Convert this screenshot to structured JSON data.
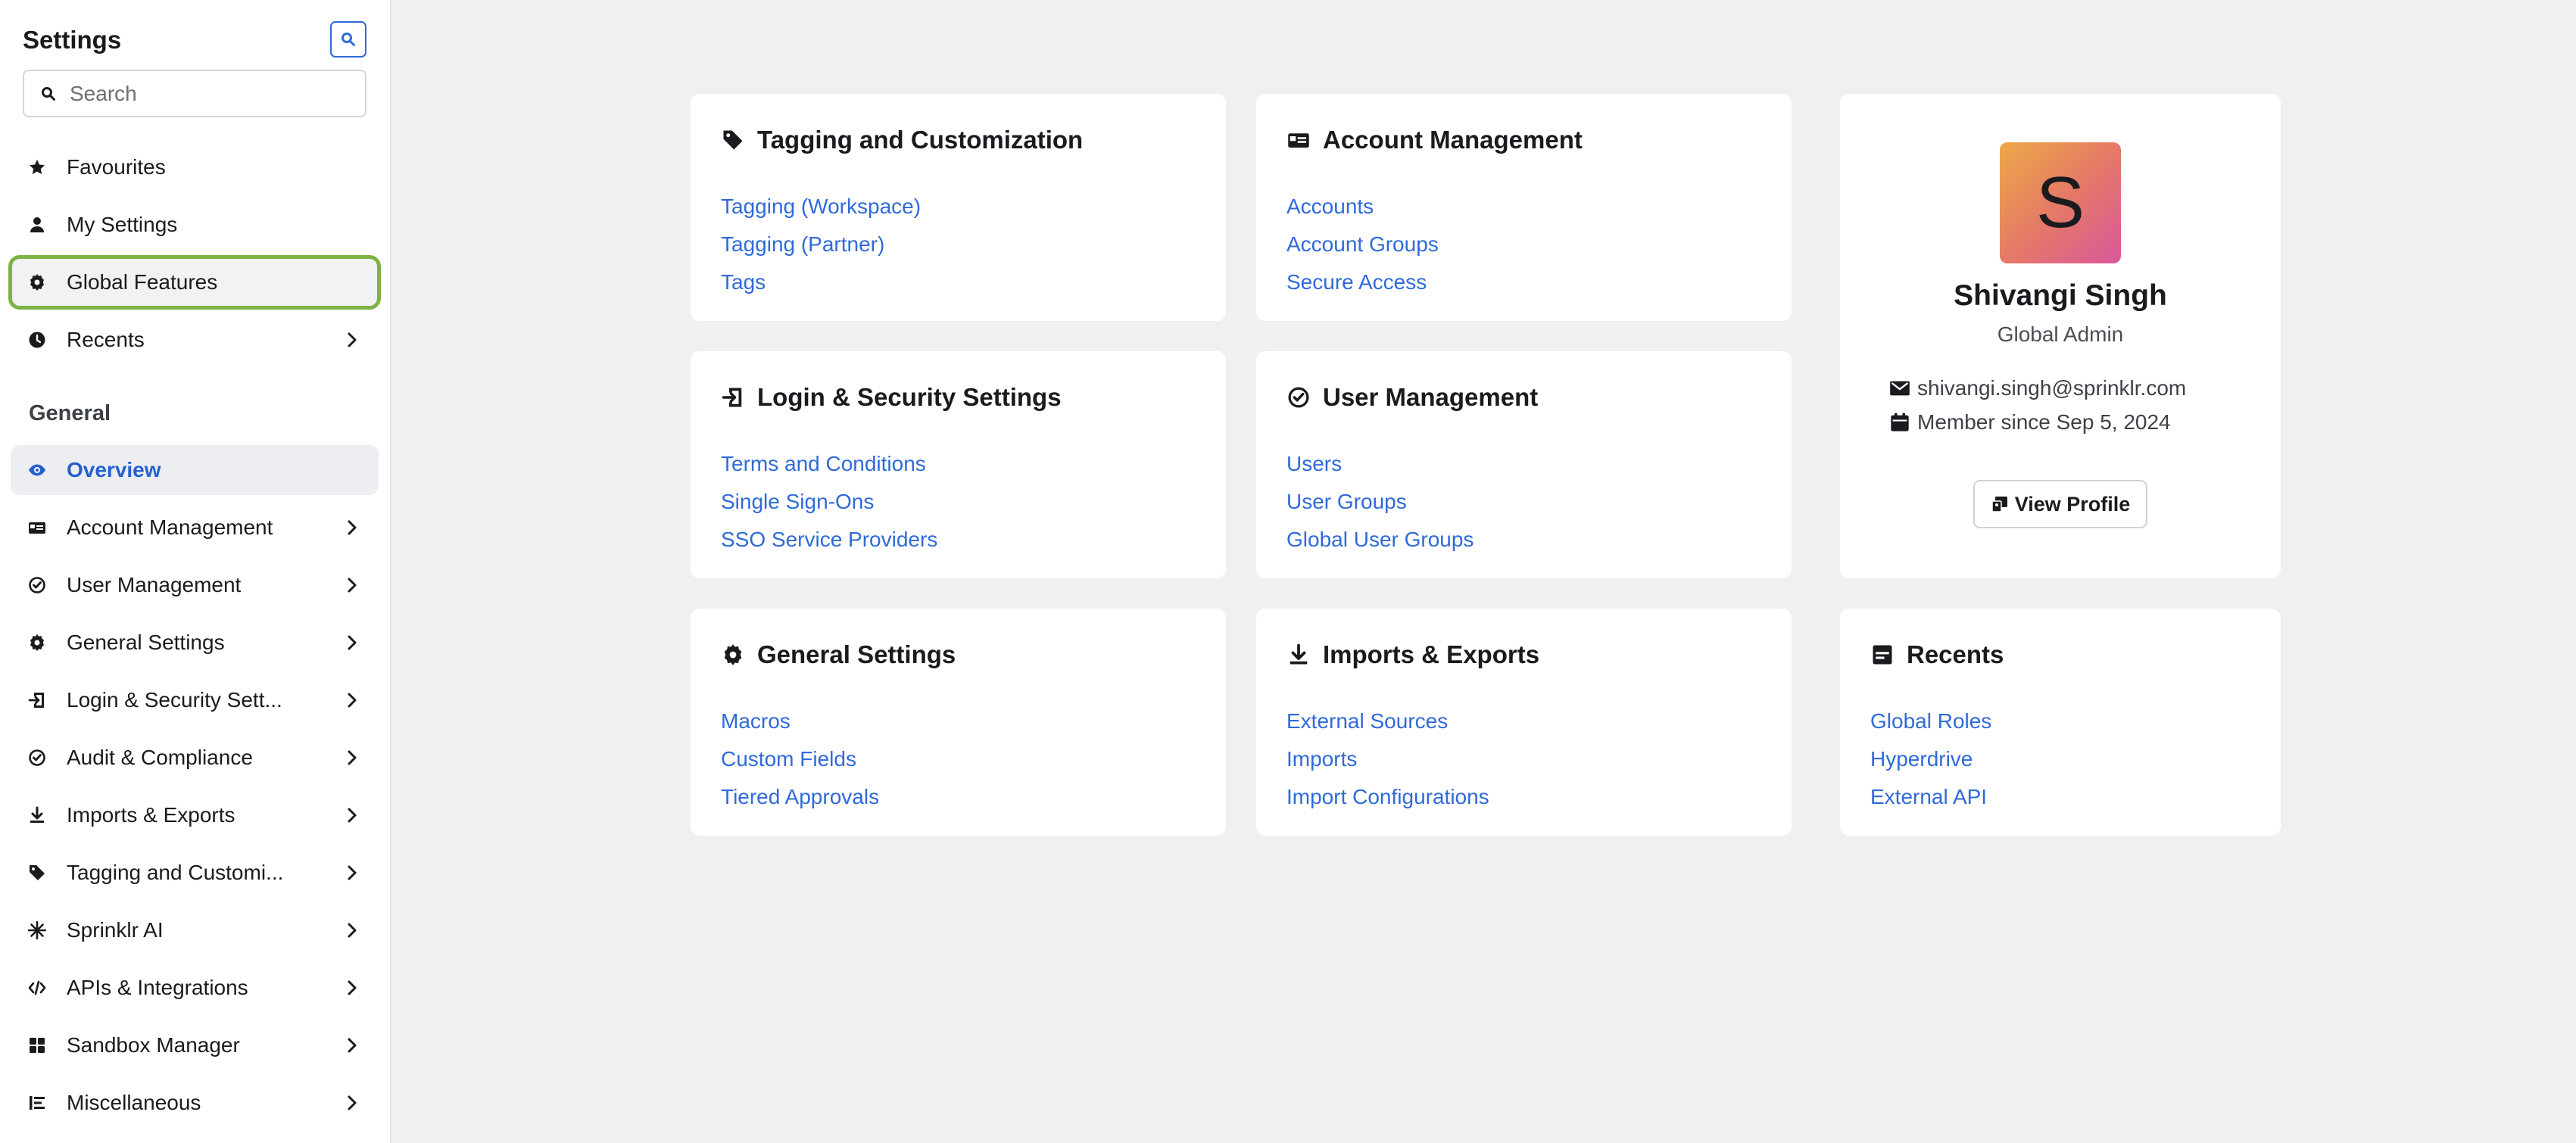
{
  "sidebar": {
    "title": "Settings",
    "search_placeholder": "Search",
    "top_items": [
      {
        "label": "Favourites",
        "icon": "star-icon"
      },
      {
        "label": "My Settings",
        "icon": "user-icon"
      },
      {
        "label": "Global Features",
        "icon": "gear-icon"
      },
      {
        "label": "Recents",
        "icon": "clock-icon"
      }
    ],
    "section_label": "General",
    "general_items": [
      {
        "label": "Overview",
        "icon": "eye-icon"
      },
      {
        "label": "Account Management",
        "icon": "id-card-icon"
      },
      {
        "label": "User Management",
        "icon": "check-circle-icon"
      },
      {
        "label": "General Settings",
        "icon": "gear-icon"
      },
      {
        "label": "Login & Security Sett...",
        "icon": "login-icon"
      },
      {
        "label": "Audit & Compliance",
        "icon": "check-circle-icon"
      },
      {
        "label": "Imports & Exports",
        "icon": "download-icon"
      },
      {
        "label": "Tagging and Customi...",
        "icon": "tag-icon"
      },
      {
        "label": "Sprinklr AI",
        "icon": "sparkle-icon"
      },
      {
        "label": "APIs & Integrations",
        "icon": "code-icon"
      },
      {
        "label": "Sandbox Manager",
        "icon": "grid-icon"
      },
      {
        "label": "Miscellaneous",
        "icon": "list-icon"
      }
    ]
  },
  "cards": [
    {
      "title": "Tagging and Customization",
      "icon": "tag-icon",
      "links": [
        "Tagging (Workspace)",
        "Tagging (Partner)",
        "Tags"
      ]
    },
    {
      "title": "Account Management",
      "icon": "id-card-icon",
      "links": [
        "Accounts",
        "Account Groups",
        "Secure Access"
      ]
    },
    {
      "title": "Login & Security Settings",
      "icon": "login-icon",
      "links": [
        "Terms and Conditions",
        "Single Sign-Ons",
        "SSO Service Providers"
      ]
    },
    {
      "title": "User Management",
      "icon": "check-circle-icon",
      "links": [
        "Users",
        "User Groups",
        "Global User Groups"
      ]
    },
    {
      "title": "General Settings",
      "icon": "gear-icon",
      "links": [
        "Macros",
        "Custom Fields",
        "Tiered Approvals"
      ]
    },
    {
      "title": "Imports & Exports",
      "icon": "download-icon",
      "links": [
        "External Sources",
        "Imports",
        "Import Configurations"
      ]
    },
    {
      "title": "Recents",
      "icon": "recents-icon",
      "links": [
        "Global Roles",
        "Hyperdrive",
        "External API"
      ]
    }
  ],
  "profile": {
    "initial": "S",
    "name": "Shivangi Singh",
    "role": "Global Admin",
    "email": "shivangi.singh@sprinklr.com",
    "member_since": "Member since Sep 5, 2024",
    "view_profile_label": "View Profile"
  },
  "colors": {
    "accent": "#2f6ad9",
    "highlight_outline": "#7cb342",
    "background": "#eef0f2"
  }
}
